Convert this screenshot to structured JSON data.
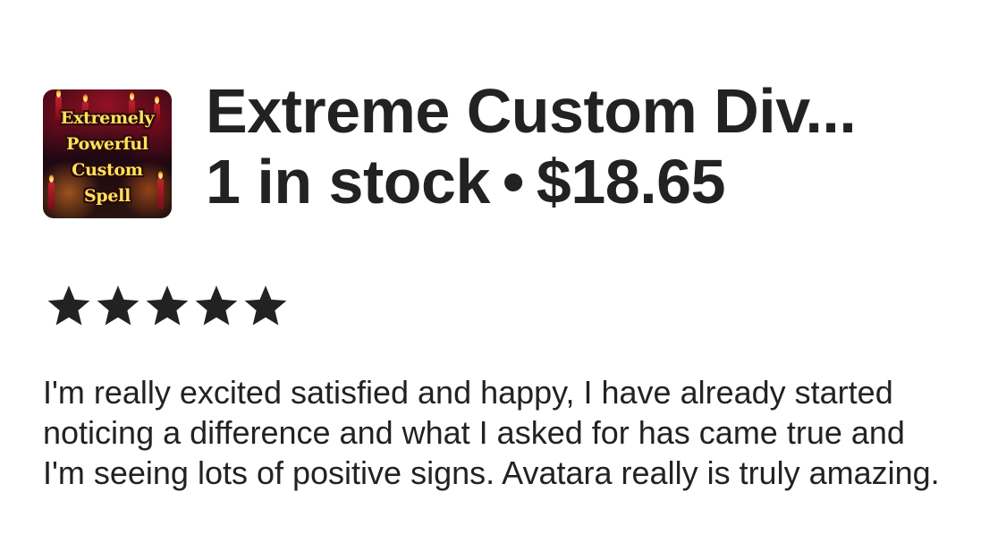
{
  "listing": {
    "thumbnail": {
      "caption": "Extremely\nPowerful\nCustom\nSpell",
      "description_icon": "spell-candles-thumbnail"
    },
    "title": "Extreme Custom Div...",
    "stock": "1 in stock",
    "separator": "•",
    "price": "$18.65"
  },
  "review": {
    "rating": 5,
    "rating_max": 5,
    "star_icon": "star-icon",
    "star_color": "#222222",
    "text": "I'm really excited satisfied and happy, I have already started noticing a difference and what I asked for has came true and I'm seeing lots of positive signs. Avatara really is truly amazing."
  }
}
